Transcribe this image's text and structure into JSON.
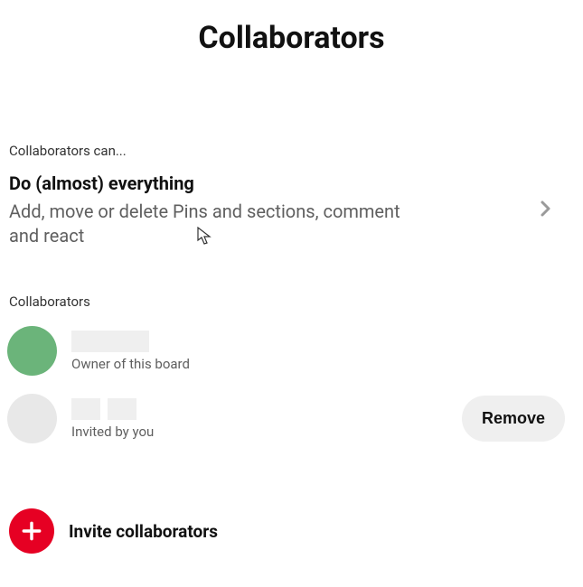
{
  "header": {
    "title": "Collaborators"
  },
  "permissions": {
    "label": "Collaborators can...",
    "option_title": "Do (almost) everything",
    "option_desc": "Add, move or delete Pins and sections, comment and react"
  },
  "collaborators": {
    "label": "Collaborators",
    "list": [
      {
        "status": "Owner of this board",
        "avatar_color": "green"
      },
      {
        "status": "Invited by you",
        "avatar_color": "gray",
        "removable": true
      }
    ],
    "remove_label": "Remove"
  },
  "invite": {
    "label": "Invite collaborators"
  },
  "colors": {
    "accent": "#e60023"
  }
}
